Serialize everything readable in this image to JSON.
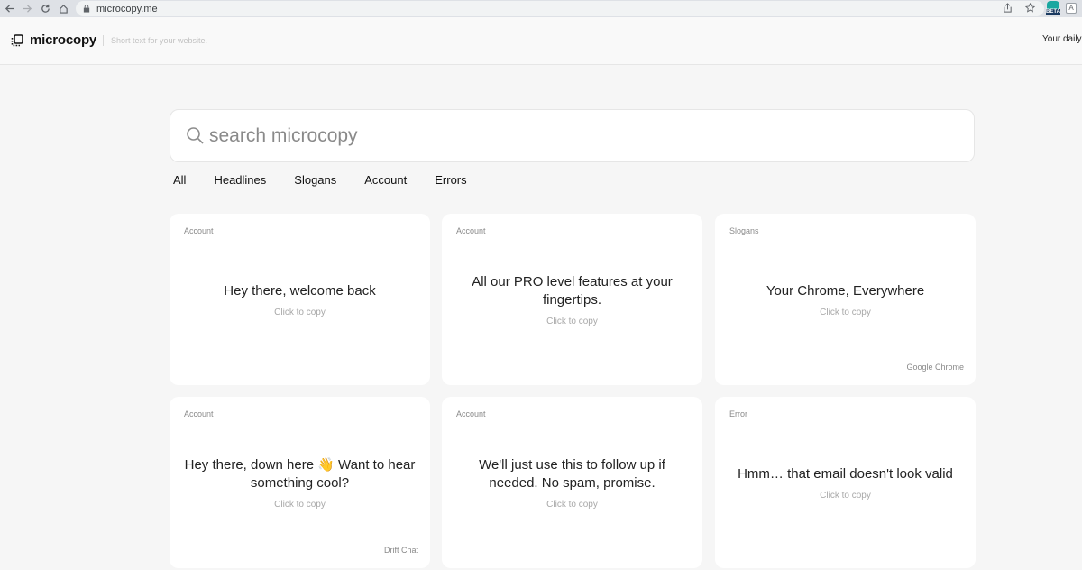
{
  "browser": {
    "url": "microcopy.me",
    "beta_label": "BETA",
    "profile_letter": "A"
  },
  "header": {
    "logo_text": "microcopy",
    "tagline": "Short text for your website.",
    "right_text": "Your daily"
  },
  "search": {
    "placeholder": "search microcopy"
  },
  "tabs": [
    {
      "label": "All"
    },
    {
      "label": "Headlines"
    },
    {
      "label": "Slogans"
    },
    {
      "label": "Account"
    },
    {
      "label": "Errors"
    }
  ],
  "cards": [
    {
      "category": "Account",
      "text": "Hey there, welcome back",
      "copy": "Click to copy",
      "source": ""
    },
    {
      "category": "Account",
      "text": "All our PRO level features at your fingertips.",
      "copy": "Click to copy",
      "source": ""
    },
    {
      "category": "Slogans",
      "text": "Your Chrome, Everywhere",
      "copy": "Click to copy",
      "source": "Google Chrome"
    },
    {
      "category": "Account",
      "text": "Hey there, down here 👋 Want to hear something cool?",
      "copy": "Click to copy",
      "source": "Drift Chat"
    },
    {
      "category": "Account",
      "text": "We'll just use this to follow up if needed. No spam, promise.",
      "copy": "Click to copy",
      "source": ""
    },
    {
      "category": "Error",
      "text": "Hmm… that email doesn't look valid",
      "copy": "Click to copy",
      "source": ""
    }
  ]
}
